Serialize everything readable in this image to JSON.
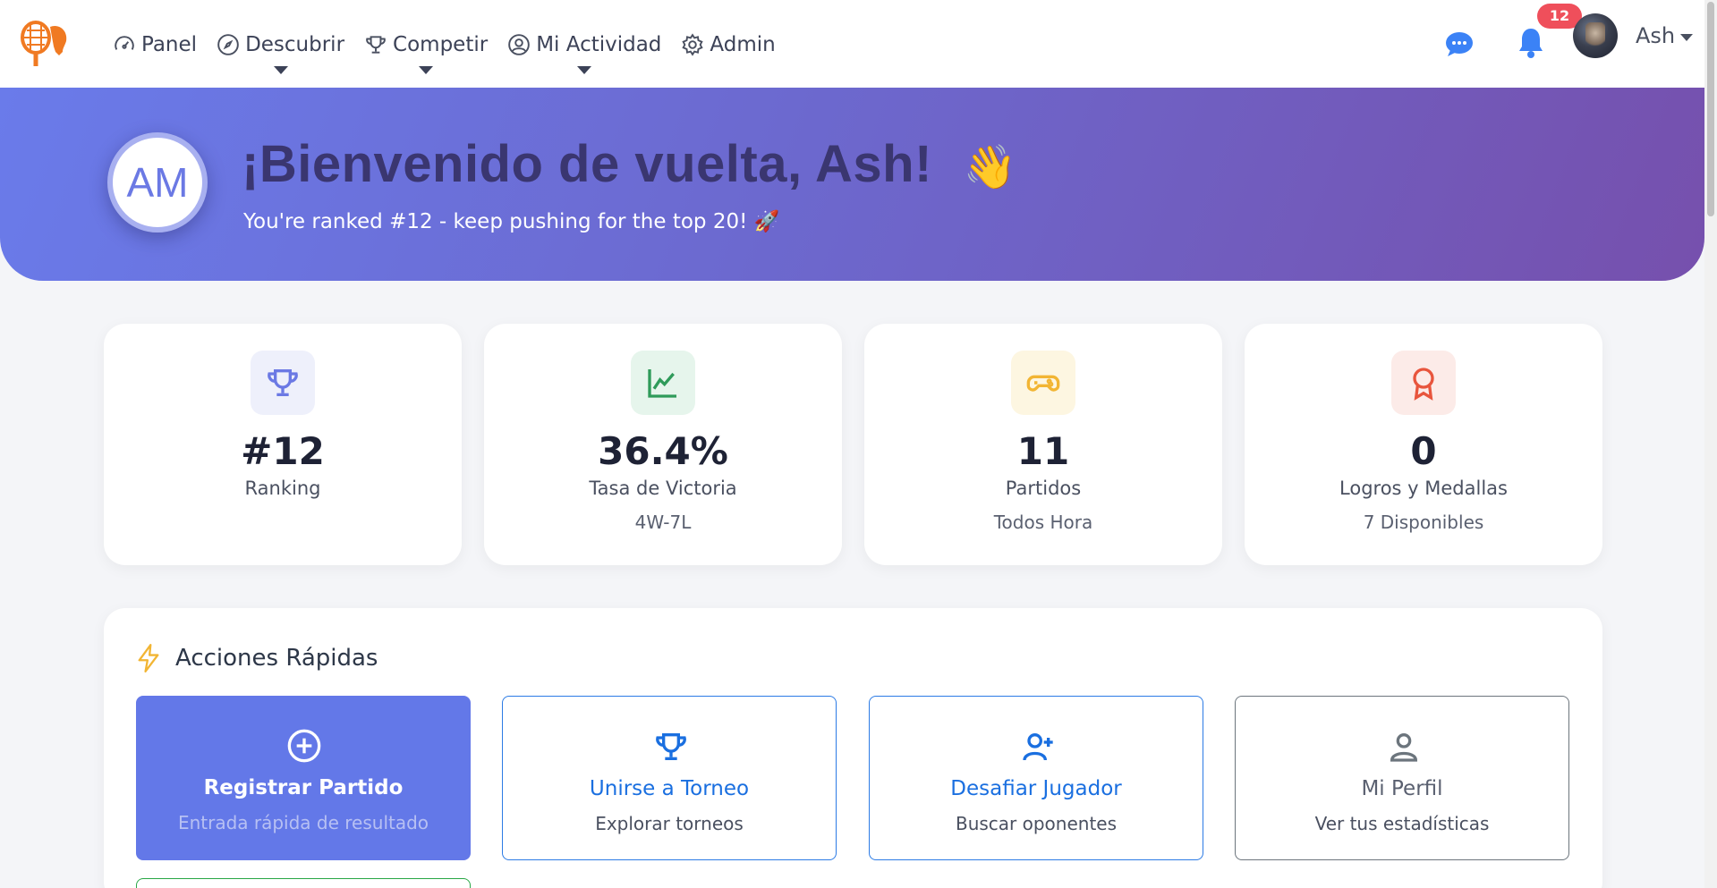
{
  "nav": {
    "items": [
      {
        "label": "Panel",
        "icon": "gauge-icon",
        "dropdown": false
      },
      {
        "label": "Descubrir",
        "icon": "compass-icon",
        "dropdown": true
      },
      {
        "label": "Competir",
        "icon": "trophy-icon",
        "dropdown": true
      },
      {
        "label": "Mi Actividad",
        "icon": "user-circle-icon",
        "dropdown": true
      },
      {
        "label": "Admin",
        "icon": "gear-icon",
        "dropdown": false
      }
    ],
    "notifications_count": "12",
    "user_name": "Ash"
  },
  "hero": {
    "initials": "AM",
    "title": "¡Bienvenido de vuelta, Ash!",
    "wave": "👋",
    "subtitle": "You're ranked #12 - keep pushing for the top 20! 🚀"
  },
  "stats": [
    {
      "icon": "trophy-icon",
      "value": "#12",
      "label": "Ranking",
      "sub": "",
      "color": "#6b79e4",
      "bg": "#eef0fb"
    },
    {
      "icon": "chart-line-icon",
      "value": "36.4%",
      "label": "Tasa de Victoria",
      "sub": "4W-7L",
      "color": "#2f9b5a",
      "bg": "#e6f5ec"
    },
    {
      "icon": "gamepad-icon",
      "value": "11",
      "label": "Partidos",
      "sub": "Todos Hora",
      "color": "#f2b533",
      "bg": "#fdf6e1"
    },
    {
      "icon": "award-icon",
      "value": "0",
      "label": "Logros y Medallas",
      "sub": "7 Disponibles",
      "color": "#e8553d",
      "bg": "#fcebe8"
    }
  ],
  "quick_actions": {
    "title": "Acciones Rápidas",
    "items": [
      {
        "icon": "plus-circle-icon",
        "title": "Registrar Partido",
        "sub": "Entrada rápida de resultado"
      },
      {
        "icon": "trophy-icon",
        "title": "Unirse a Torneo",
        "sub": "Explorar torneos"
      },
      {
        "icon": "user-plus-icon",
        "title": "Desafiar Jugador",
        "sub": "Buscar oponentes"
      },
      {
        "icon": "person-icon",
        "title": "Mi Perfil",
        "sub": "Ver tus estadísticas"
      }
    ]
  },
  "colors": {
    "primary": "#6378e8",
    "hero_gradient_start": "#6a7bea",
    "hero_gradient_end": "#7650ad",
    "badge": "#ef4f5b",
    "link_blue": "#1a6fe0"
  }
}
